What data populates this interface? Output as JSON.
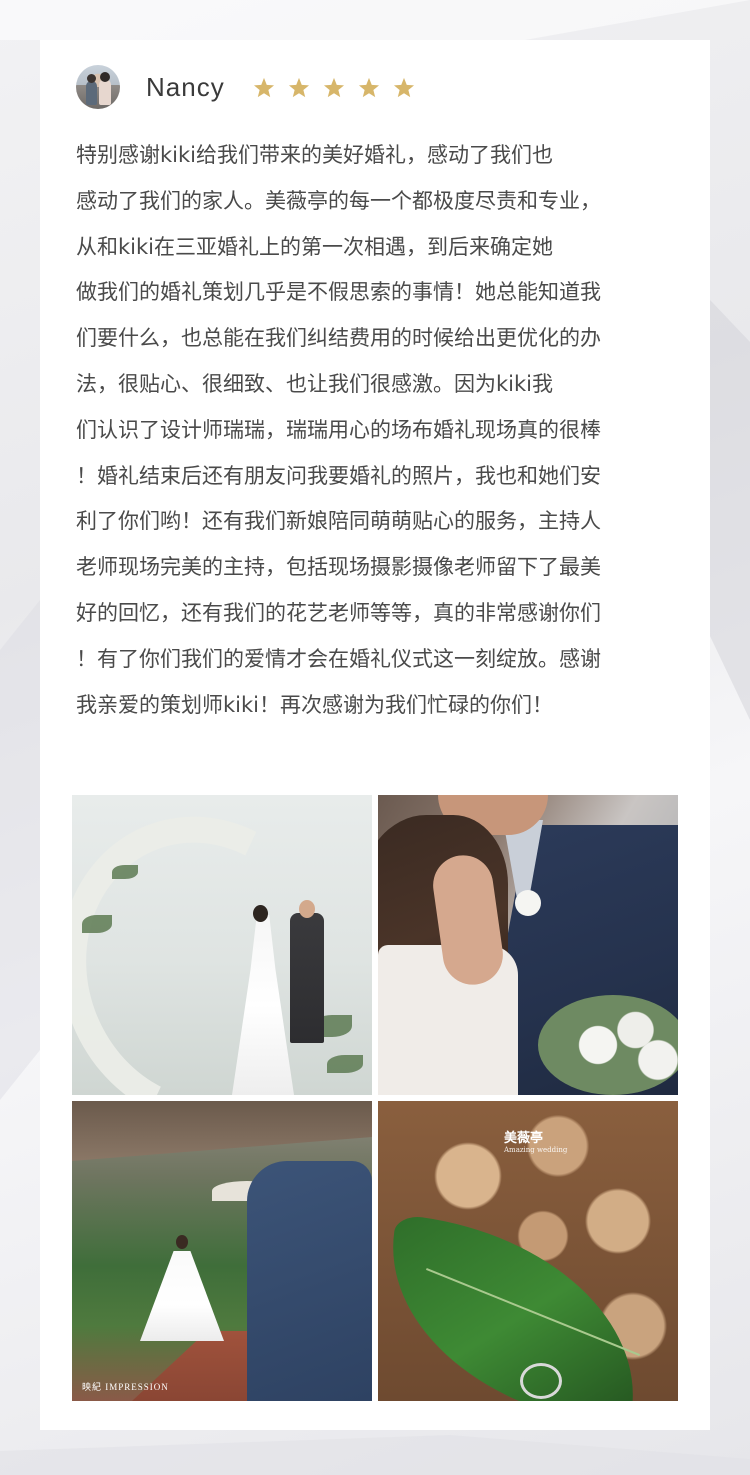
{
  "review": {
    "reviewer_name": "Nancy",
    "rating": 5,
    "max_rating": 5,
    "star_color": "#D7B66A",
    "text_lines": [
      "特别感谢kiki给我们带来的美好婚礼，感动了我们也",
      "感动了我们的家人。美薇亭的每一个都极度尽责和专业，",
      "从和kiki在三亚婚礼上的第一次相遇，到后来确定她",
      "做我们的婚礼策划几乎是不假思索的事情！她总能知道我",
      "们要什么，也总能在我们纠结费用的时候给出更优化的办",
      "法，很贴心、很细致、也让我们很感激。因为kiki我",
      "们认识了设计师瑞瑞，瑞瑞用心的场布婚礼现场真的很棒",
      "！婚礼结束后还有朋友问我要婚礼的照片，我也和她们安",
      "利了你们哟！还有我们新娘陪同萌萌贴心的服务，主持人",
      "老师现场完美的主持，包括现场摄影摄像老师留下了最美",
      "好的回忆，还有我们的花艺老师等等，真的非常感谢你们",
      "！有了你们我们的爱情才会在婚礼仪式这一刻绽放。感谢",
      "我亲爱的策划师kiki！再次感谢为我们忙碌的你们！"
    ]
  },
  "gallery": {
    "photos": [
      {
        "subject": "ceremony-floral-arch"
      },
      {
        "subject": "couple-embrace-bouquet"
      },
      {
        "subject": "bride-garden-path",
        "watermark": "映紀 IMPRESSION"
      },
      {
        "subject": "rings-on-leaf",
        "watermark_title": "美薇亭",
        "watermark_sub": "Amazing wedding"
      }
    ]
  }
}
